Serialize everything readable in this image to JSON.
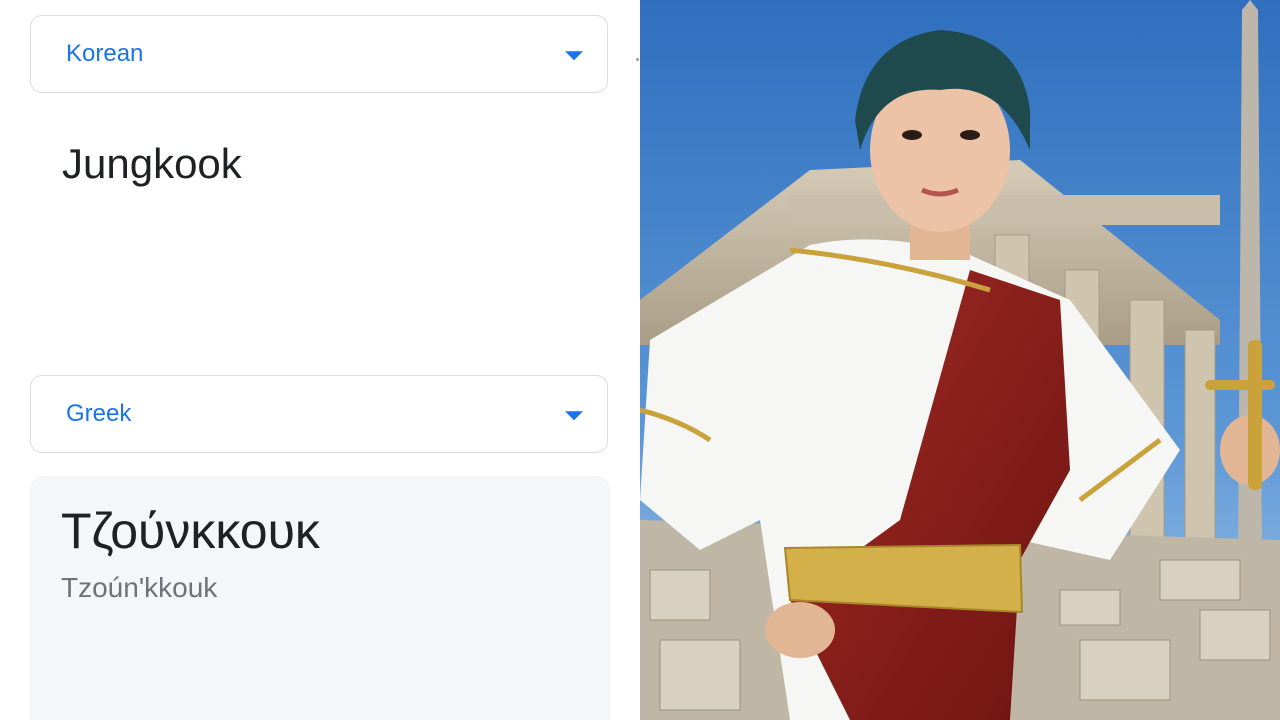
{
  "source": {
    "language": "Korean",
    "text": "Jungkook"
  },
  "target": {
    "language": "Greek",
    "text": "Τζούνκκουκ",
    "transliteration": "Tzoún'kkouk"
  },
  "colors": {
    "accent": "#1a73e8",
    "result_bg": "#f5f6f9",
    "sky": "#3a7bc8"
  },
  "icons": {
    "source_dropdown": "chevron-down-icon",
    "target_dropdown": "chevron-down-icon"
  }
}
